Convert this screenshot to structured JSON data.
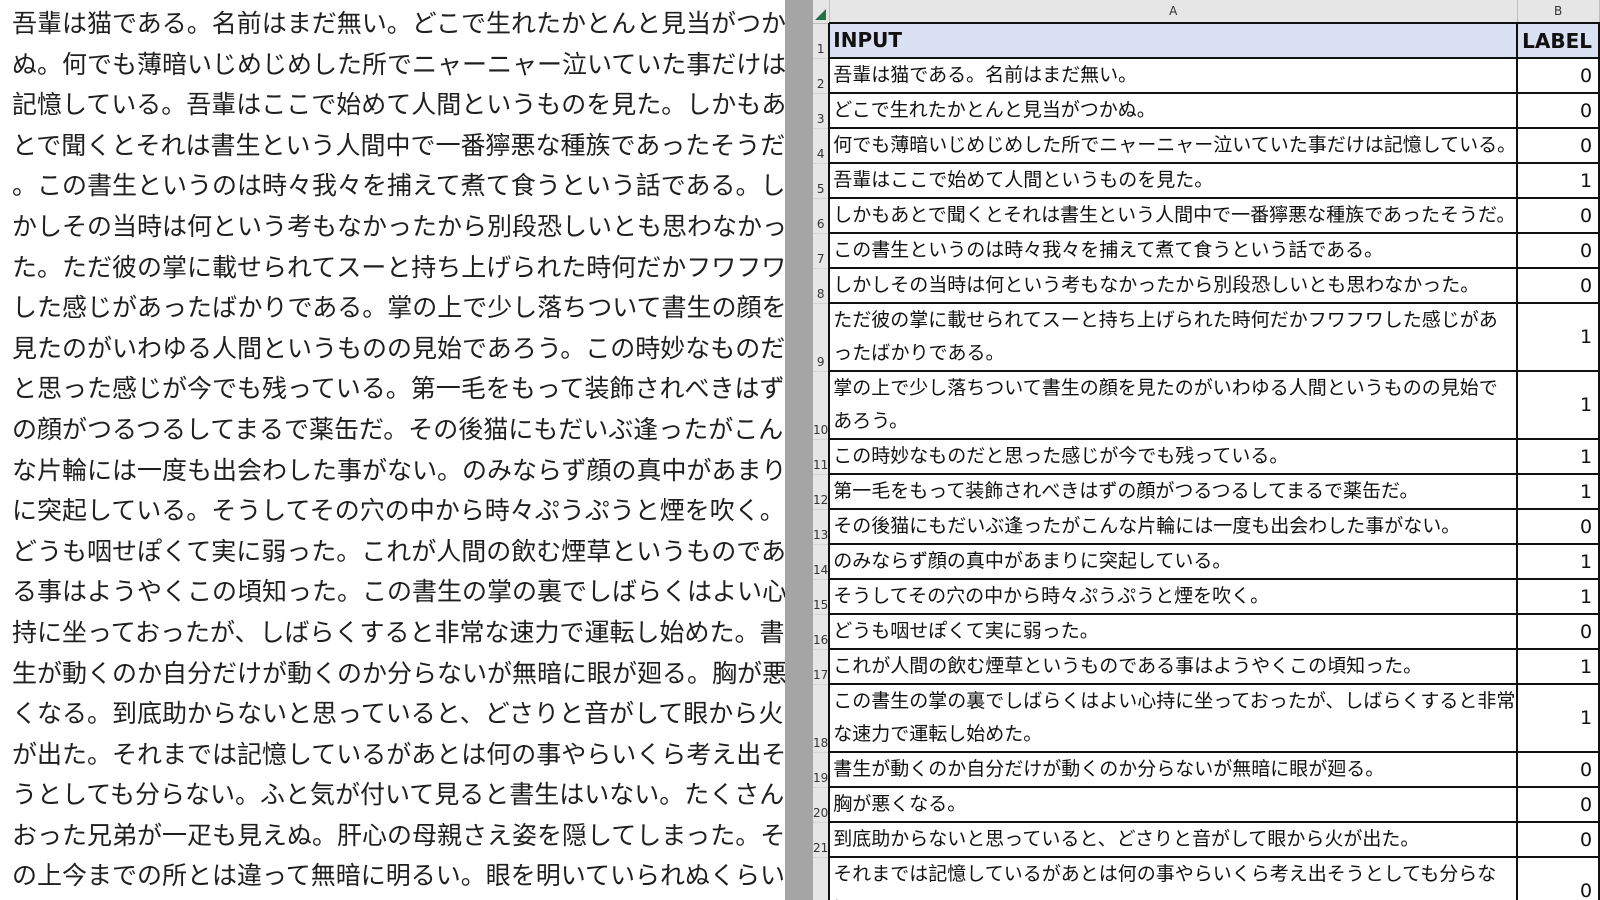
{
  "left_text_lines": [
    "吾輩は猫である。名前はまだ無い。どこで生れたかとんと見当がつか",
    "ぬ。何でも薄暗いじめじめした所でニャーニャー泣いていた事だけは",
    "記憶している。吾輩はここで始めて人間というものを見た。しかもあ",
    "とで聞くとそれは書生という人間中で一番獰悪な種族であったそうだ",
    "。この書生というのは時々我々を捕えて煮て食うという話である。し",
    "かしその当時は何という考もなかったから別段恐しいとも思わなかっ",
    "た。ただ彼の掌に載せられてスーと持ち上げられた時何だかフワフワ",
    "した感じがあったばかりである。掌の上で少し落ちついて書生の顔を",
    "見たのがいわゆる人間というものの見始であろう。この時妙なものだ",
    "と思った感じが今でも残っている。第一毛をもって装飾されべきはず",
    "の顔がつるつるしてまるで薬缶だ。その後猫にもだいぶ逢ったがこん",
    "な片輪には一度も出会わした事がない。のみならず顔の真中があまり",
    "に突起している。そうしてその穴の中から時々ぷうぷうと煙を吹く。",
    "どうも咽せぽくて実に弱った。これが人間の飲む煙草というものであ",
    "る事はようやくこの頃知った。この書生の掌の裏でしばらくはよい心",
    "持に坐っておったが、しばらくすると非常な速力で運転し始めた。書",
    "生が動くのか自分だけが動くのか分らないが無暗に眼が廻る。胸が悪",
    "くなる。到底助からないと思っていると、どさりと音がして眼から火",
    "が出た。それまでは記憶しているがあとは何の事やらいくら考え出そ",
    "うとしても分らない。ふと気が付いて見ると書生はいない。たくさん",
    "おった兄弟が一疋も見えぬ。肝心の母親さえ姿を隠してしまった。そ",
    "の上今までの所とは違って無暗に明るい。眼を明いていられぬくらい"
  ],
  "sheet": {
    "columns": [
      "A",
      "B"
    ],
    "header": {
      "row": "1",
      "input": "INPUT",
      "label": "LABEL"
    },
    "rows": [
      {
        "row": "2",
        "input": "吾輩は猫である。名前はまだ無い。",
        "label": "0"
      },
      {
        "row": "3",
        "input": "どこで生れたかとんと見当がつかぬ。",
        "label": "0"
      },
      {
        "row": "4",
        "input": "何でも薄暗いじめじめした所でニャーニャー泣いていた事だけは記憶している。",
        "label": "0"
      },
      {
        "row": "5",
        "input": "吾輩はここで始めて人間というものを見た。",
        "label": "1"
      },
      {
        "row": "6",
        "input": "しかもあとで聞くとそれは書生という人間中で一番獰悪な種族であったそうだ。",
        "label": "0"
      },
      {
        "row": "7",
        "input": "この書生というのは時々我々を捕えて煮て食うという話である。",
        "label": "0"
      },
      {
        "row": "8",
        "input": "しかしその当時は何という考もなかったから別段恐しいとも思わなかった。",
        "label": "0"
      },
      {
        "row": "9",
        "input": "ただ彼の掌に載せられてスーと持ち上げられた時何だかフワフワした感じがあったばかりである。",
        "label": "1"
      },
      {
        "row": "10",
        "input": "掌の上で少し落ちついて書生の顔を見たのがいわゆる人間というものの見始であろう。",
        "label": "1"
      },
      {
        "row": "11",
        "input": "この時妙なものだと思った感じが今でも残っている。",
        "label": "1"
      },
      {
        "row": "12",
        "input": "第一毛をもって装飾されべきはずの顔がつるつるしてまるで薬缶だ。",
        "label": "1"
      },
      {
        "row": "13",
        "input": "その後猫にもだいぶ逢ったがこんな片輪には一度も出会わした事がない。",
        "label": "0"
      },
      {
        "row": "14",
        "input": "のみならず顔の真中があまりに突起している。",
        "label": "1"
      },
      {
        "row": "15",
        "input": "そうしてその穴の中から時々ぷうぷうと煙を吹く。",
        "label": "1"
      },
      {
        "row": "16",
        "input": "どうも咽せぽくて実に弱った。",
        "label": "0"
      },
      {
        "row": "17",
        "input": "これが人間の飲む煙草というものである事はようやくこの頃知った。",
        "label": "1"
      },
      {
        "row": "18",
        "input": "この書生の掌の裏でしばらくはよい心持に坐っておったが、しばらくすると非常な速力で運転し始めた。",
        "label": "1"
      },
      {
        "row": "19",
        "input": "書生が動くのか自分だけが動くのか分らないが無暗に眼が廻る。",
        "label": "0"
      },
      {
        "row": "20",
        "input": "胸が悪くなる。",
        "label": "0"
      },
      {
        "row": "21",
        "input": "到底助からないと思っていると、どさりと音がして眼から火が出た。",
        "label": "0"
      },
      {
        "row": "22",
        "input": "それまでは記憶しているがあとは何の事やらいくら考え出そうとしても分らない。",
        "label": "0"
      }
    ]
  }
}
